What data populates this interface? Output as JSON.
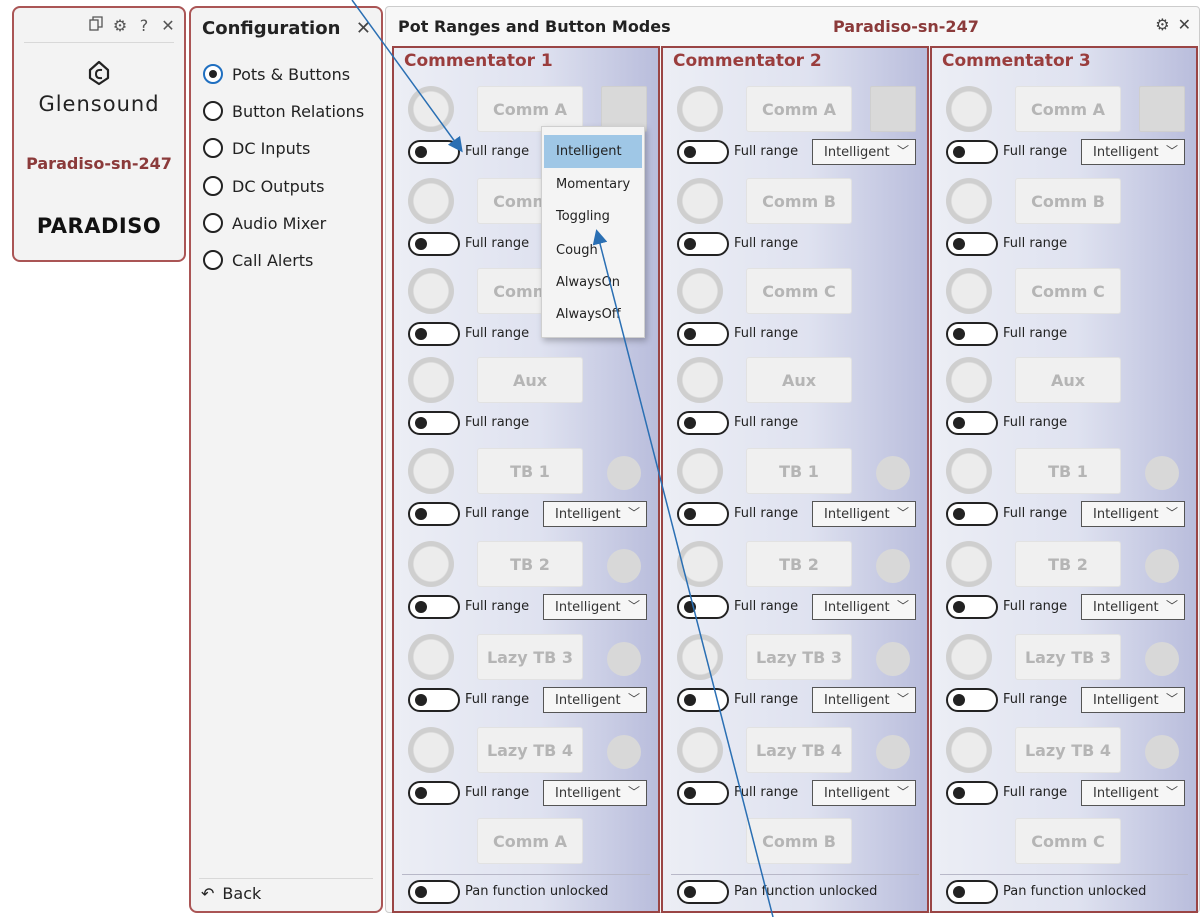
{
  "device_panel": {
    "brand": "Glensound",
    "device_name": "Paradiso-sn-247",
    "product": "PARADISO",
    "icons": [
      "copy-icon",
      "gear-icon",
      "help-icon",
      "close-icon"
    ]
  },
  "config": {
    "title": "Configuration",
    "close": "×",
    "items": [
      {
        "label": "Pots & Buttons",
        "selected": true
      },
      {
        "label": "Button Relations",
        "selected": false
      },
      {
        "label": "DC Inputs",
        "selected": false
      },
      {
        "label": "DC Outputs",
        "selected": false
      },
      {
        "label": "Audio Mixer",
        "selected": false
      },
      {
        "label": "Call Alerts",
        "selected": false
      }
    ],
    "back": "Back"
  },
  "main": {
    "title": "Pot Ranges and Button Modes",
    "device": "Paradiso-sn-247",
    "full_range_label": "Full range",
    "mode_value": "Intelligent",
    "pan_label": "Pan function unlocked",
    "commentators": [
      {
        "name": "Commentator 1",
        "buttons": [
          "Comm A",
          "Comm B",
          "Comm C",
          "Aux",
          "TB 1",
          "TB 2",
          "Lazy TB 3",
          "Lazy TB 4"
        ],
        "bottom": "Comm A"
      },
      {
        "name": "Commentator 2",
        "buttons": [
          "Comm A",
          "Comm B",
          "Comm C",
          "Aux",
          "TB 1",
          "TB 2",
          "Lazy TB 3",
          "Lazy TB 4"
        ],
        "bottom": "Comm B"
      },
      {
        "name": "Commentator 3",
        "buttons": [
          "Comm A",
          "Comm B",
          "Comm C",
          "Aux",
          "TB 1",
          "TB 2",
          "Lazy TB 3",
          "Lazy TB 4"
        ],
        "bottom": "Comm C"
      }
    ]
  },
  "dropdown": {
    "options": [
      "Intelligent",
      "Momentary",
      "Toggling",
      "Cough",
      "AlwaysOn",
      "AlwaysOff"
    ],
    "selected": "Intelligent"
  },
  "colors": {
    "accent": "#9a3d3d",
    "selection": "#9fc7e6",
    "arrow": "#2a6fb3"
  }
}
